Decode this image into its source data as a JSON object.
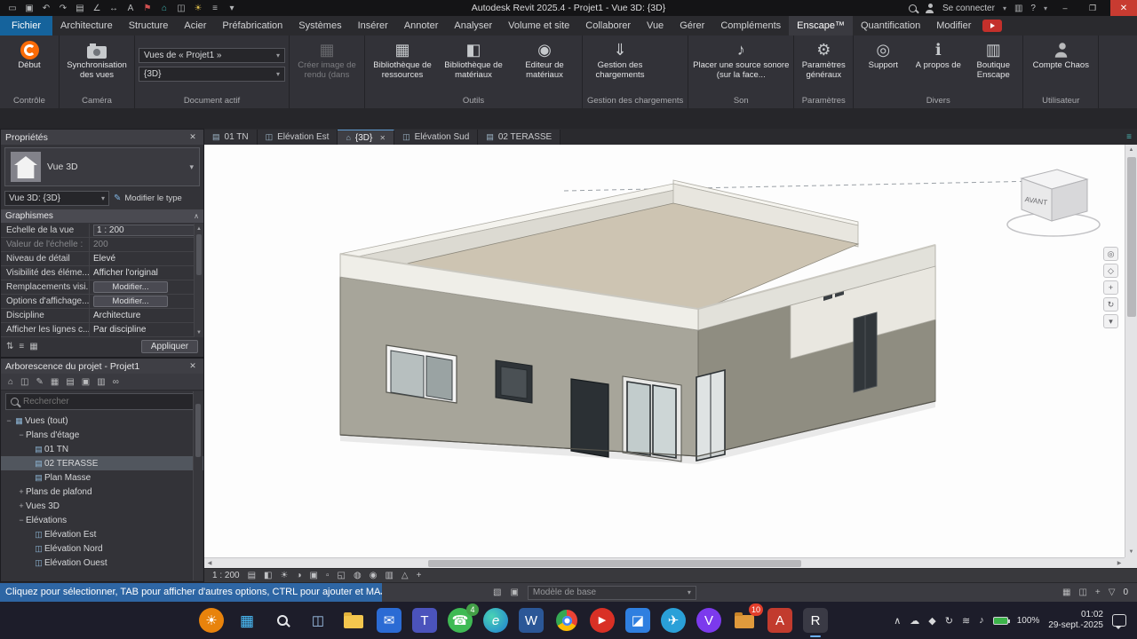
{
  "ui": {
    "caret": "▾",
    "up": "▲",
    "down": "▼",
    "left": "◀",
    "right": "▶",
    "close": "✕",
    "minus": "−",
    "plus": "+",
    "chev": "∧",
    "plan": "▤",
    "elev": "◫",
    "home": "⌂",
    "views": "▦",
    "menu": "≡"
  },
  "glyphs": {
    "assets": "▦",
    "materials": "◧",
    "editor": "◉",
    "download": "⇓",
    "sound": "♪",
    "gear": "⚙",
    "support": "◎",
    "info": "ℹ",
    "shop": "▥"
  },
  "titlebar": {
    "title": "Autodesk Revit 2025.4 - Projet1 - Vue 3D: {3D}",
    "signin": "Se connecter",
    "help": "?",
    "min": "–",
    "max": "❐",
    "close": "✕",
    "qat": [
      {
        "name": "open",
        "glyph": "▭"
      },
      {
        "name": "save",
        "glyph": "▣"
      },
      {
        "name": "undo",
        "glyph": "↶"
      },
      {
        "name": "redo",
        "glyph": "↷"
      },
      {
        "name": "print",
        "glyph": "▤"
      },
      {
        "name": "measure",
        "glyph": "∠"
      },
      {
        "name": "aligned-dimension",
        "glyph": "↔"
      },
      {
        "name": "text-note",
        "glyph": "A"
      },
      {
        "name": "tag",
        "glyph": "⚑"
      },
      {
        "name": "default-3d-view",
        "glyph": "⌂"
      },
      {
        "name": "section",
        "glyph": "◫"
      },
      {
        "name": "sun-settings",
        "glyph": "☀"
      },
      {
        "name": "thin-lines",
        "glyph": "≡"
      }
    ]
  },
  "tabs": {
    "items": [
      "Fichier",
      "Architecture",
      "Structure",
      "Acier",
      "Préfabrication",
      "Systèmes",
      "Insérer",
      "Annoter",
      "Analyser",
      "Volume et site",
      "Collaborer",
      "Vue",
      "Gérer",
      "Compléments",
      "Enscape™",
      "Quantification",
      "Modifier"
    ]
  },
  "ribbon": {
    "controle": {
      "label": "Contrôle",
      "start": "Début"
    },
    "camera": {
      "label": "Caméra",
      "sync": "Synchronisation des vues"
    },
    "document": {
      "label": "Document actif",
      "views_combo": "Vues de « Projet1 »",
      "view_combo": "{3D}"
    },
    "rendu": {
      "label": "",
      "create": "Créer image de rendu (dans"
    },
    "outils": {
      "label": "Outils",
      "assets": "Bibliothèque de ressources",
      "materials": "Bibliothèque de matériaux",
      "editor": "Éditeur de matériaux"
    },
    "chargements": {
      "label": "Gestion des chargements",
      "button": "Gestion des chargements"
    },
    "son": {
      "label": "Son",
      "button": "Placer une source sonore (sur la face..."
    },
    "parametres": {
      "label": "Paramètres",
      "button": "Paramètres généraux"
    },
    "divers": {
      "label": "Divers",
      "support": "Support",
      "apropos": "À propos de",
      "boutique": "Boutique Enscape"
    },
    "utilisateur": {
      "label": "Utilisateur",
      "button": "Compte Chaos"
    }
  },
  "properties": {
    "title": "Propriétés",
    "type_label": "Vue 3D",
    "instance_combo": "Vue 3D: {3D}",
    "edit_type": "Modifier le type",
    "section": "Graphismes",
    "rows": [
      {
        "label": "Echelle de la vue",
        "value": "1 : 200"
      },
      {
        "label": "Valeur de l'échelle :",
        "value": "200"
      },
      {
        "label": "Niveau de détail",
        "value": "Elevé"
      },
      {
        "label": "Visibilité des éléme...",
        "value": "Afficher l'original"
      },
      {
        "label": "Remplacements visi...",
        "value": "Modifier..."
      },
      {
        "label": "Options d'affichage...",
        "value": "Modifier..."
      },
      {
        "label": "Discipline",
        "value": "Architecture"
      },
      {
        "label": "Afficher les lignes c...",
        "value": "Par discipline"
      }
    ],
    "apply": "Appliquer"
  },
  "browser": {
    "title": "Arborescence du projet - Projet1",
    "search_placeholder": "Rechercher",
    "toolbar": [
      {
        "name": "home",
        "glyph": "⌂"
      },
      {
        "name": "views",
        "glyph": "◫"
      },
      {
        "name": "edit",
        "glyph": "✎"
      },
      {
        "name": "sheets",
        "glyph": "▦"
      },
      {
        "name": "schedules",
        "glyph": "▤"
      },
      {
        "name": "families",
        "glyph": "▣"
      },
      {
        "name": "groups",
        "glyph": "▥"
      },
      {
        "name": "links",
        "glyph": "∞"
      }
    ],
    "tree": [
      {
        "label": "Vues (tout)"
      },
      {
        "label": "Plans d'étage"
      },
      {
        "label": "01 TN"
      },
      {
        "label": "02 TERASSE"
      },
      {
        "label": "Plan Masse"
      },
      {
        "label": "Plans de plafond"
      },
      {
        "label": "Vues 3D"
      },
      {
        "label": "Elévations"
      },
      {
        "label": "Elévation Est"
      },
      {
        "label": "Elévation Nord"
      },
      {
        "label": "Elévation Ouest"
      }
    ]
  },
  "view_tabs": [
    {
      "label": "01 TN"
    },
    {
      "label": "Elévation Est"
    },
    {
      "label": "{3D}"
    },
    {
      "label": "Elévation Sud"
    },
    {
      "label": "02 TERASSE"
    }
  ],
  "viewport": {
    "viewcube_front": "AVANT"
  },
  "viewctrl": {
    "scale": "1 : 200",
    "icons": [
      {
        "name": "detail-level",
        "glyph": "▤"
      },
      {
        "name": "visual-style",
        "glyph": "◧"
      },
      {
        "name": "sun-path",
        "glyph": "☀"
      },
      {
        "name": "shadows",
        "glyph": "◑"
      },
      {
        "name": "render",
        "glyph": "▣"
      },
      {
        "name": "crop-view",
        "glyph": "▫"
      },
      {
        "name": "show-crop",
        "glyph": "◱"
      },
      {
        "name": "temporary-hide-isolate",
        "glyph": "◍"
      },
      {
        "name": "reveal-hidden",
        "glyph": "◉"
      },
      {
        "name": "temporary-view-properties",
        "glyph": "▥"
      },
      {
        "name": "analytical-model",
        "glyph": "△"
      },
      {
        "name": "constraints",
        "glyph": "+"
      }
    ]
  },
  "statusbar": {
    "hint": "Cliquez pour sélectionner, TAB pour afficher d'autres options, CTRL pour ajouter et MAJ po",
    "workset": "Modèle de base",
    "icons_left": [
      {
        "name": "worksharing-display",
        "glyph": "▧"
      },
      {
        "name": "design-options",
        "glyph": "▣"
      }
    ],
    "icons_right": [
      {
        "name": "select-link",
        "glyph": "▦"
      },
      {
        "name": "editable-only",
        "glyph": "◫"
      },
      {
        "name": "drag-on-selection",
        "glyph": "+"
      },
      {
        "name": "filter",
        "glyph": "▽"
      }
    ],
    "filter_count": "0"
  },
  "taskbar": {
    "apps": [
      {
        "name": "widgets-weather",
        "glyph": "☀"
      },
      {
        "name": "start",
        "glyph": "▦"
      },
      {
        "name": "search",
        "glyph": ""
      },
      {
        "name": "task-view",
        "glyph": "◫"
      },
      {
        "name": "file-explorer",
        "glyph": ""
      },
      {
        "name": "mail",
        "glyph": "✉"
      },
      {
        "name": "teams",
        "glyph": "T"
      },
      {
        "name": "whatsapp",
        "glyph": "☎",
        "badge": "4"
      },
      {
        "name": "edge",
        "glyph": "e"
      },
      {
        "name": "word",
        "glyph": "W"
      },
      {
        "name": "chrome",
        "glyph": ""
      },
      {
        "name": "media-player",
        "glyph": "▶"
      },
      {
        "name": "photos",
        "glyph": "◪"
      },
      {
        "name": "telegram",
        "glyph": "✈"
      },
      {
        "name": "visual-studio",
        "glyph": "V"
      },
      {
        "name": "downloads-folder",
        "glyph": "",
        "badge": "10"
      },
      {
        "name": "autocad",
        "glyph": "A"
      },
      {
        "name": "revit",
        "glyph": "R"
      }
    ],
    "tray_expand": "∧",
    "tray": [
      {
        "name": "onedrive",
        "glyph": "☁"
      },
      {
        "name": "security",
        "glyph": "◆"
      },
      {
        "name": "updates",
        "glyph": "↻"
      },
      {
        "name": "network",
        "glyph": "≋"
      },
      {
        "name": "volume",
        "glyph": "♪"
      }
    ],
    "battery": "100%",
    "time": "01:02",
    "date": "29-sept.-2025"
  }
}
